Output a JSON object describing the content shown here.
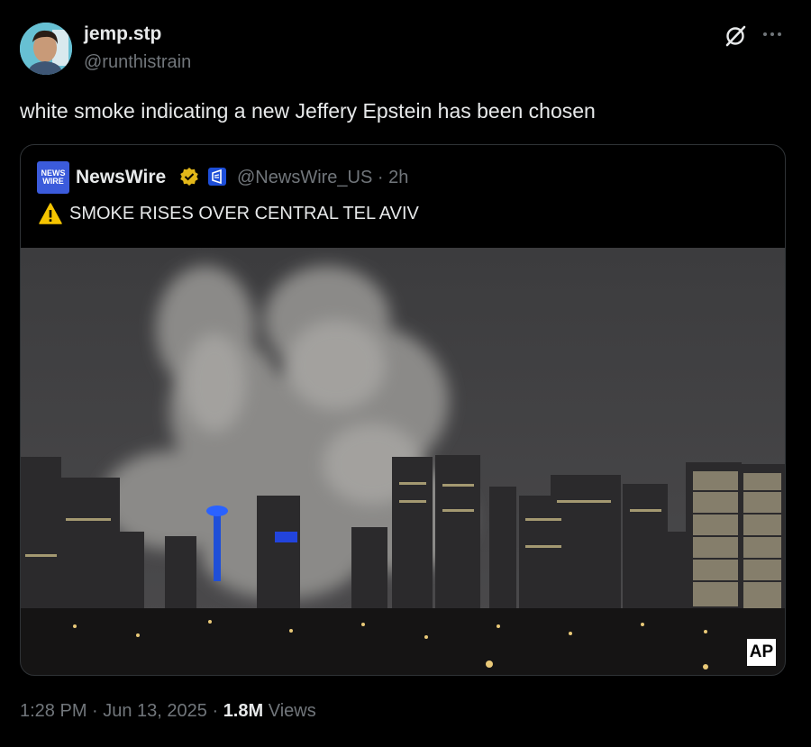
{
  "author": {
    "display_name": "jemp.stp",
    "handle": "@runthistrain"
  },
  "tweet": {
    "text": "white smoke indicating a new Jeffery Epstein has been chosen"
  },
  "quote": {
    "logo_line1": "NEWS",
    "logo_line2": "WIRE",
    "name": "NewsWire",
    "handle_time": "@NewsWire_US · 2h",
    "text": "SMOKE RISES OVER CENTRAL TEL AVIV",
    "image_badge": "AP"
  },
  "footer": {
    "time_date": "1:28 PM · Jun 13, 2025 · ",
    "views_count": "1.8M",
    "views_label": " Views"
  },
  "colors": {
    "background": "#000000",
    "text": "#e7e9ea",
    "muted": "#71767b",
    "border": "#2f3336",
    "verified_gold": "#e2b719"
  },
  "icons": [
    "grok-icon",
    "more-icon",
    "verified-badge-icon",
    "affiliate-badge-icon",
    "warning-icon"
  ]
}
